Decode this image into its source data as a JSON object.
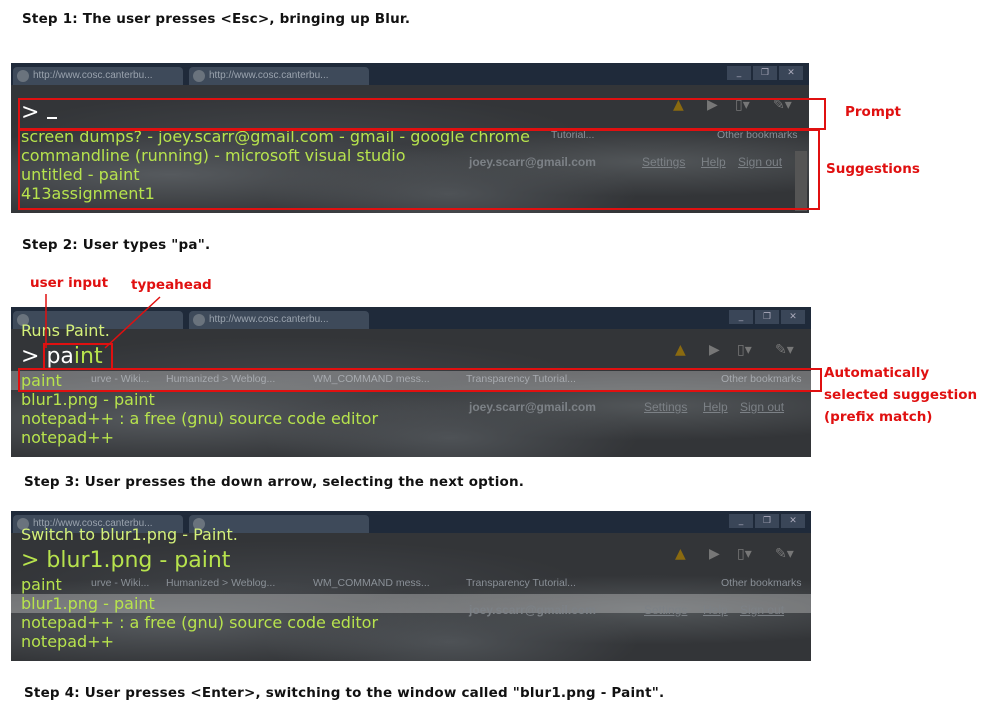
{
  "steps": {
    "s1": "Step 1: The user presses <Esc>, bringing up Blur.",
    "s2": "Step 2: User types \"pa\".",
    "s3": "Step 3: User presses the down arrow, selecting the next option.",
    "s4": "Step 4: User presses <Enter>, switching to the window called \"blur1.png - Paint\"."
  },
  "browser": {
    "tab1": "http://www.cosc.canterbu...",
    "tab2": "http://www.cosc.canterbu...",
    "account": "joey.scarr@gmail.com",
    "settings": "Settings",
    "help": "Help",
    "signout": "Sign out",
    "other_bookmarks": "Other bookmarks",
    "bookmark_tutorial": "Tutorial...",
    "bookmarks": [
      "urve - Wiki...",
      "Humanized > Weblog...",
      "WM_COMMAND mess...",
      "Transparency Tutorial..."
    ]
  },
  "shot1": {
    "prompt": ">",
    "suggestions": [
      "screen dumps? - joey.scarr@gmail.com - gmail - google chrome",
      "commandline (running) - microsoft visual studio",
      "untitled - paint",
      "413assignment1"
    ]
  },
  "shot2": {
    "status": "Runs Paint.",
    "prompt": ">",
    "typed": "pa",
    "typeahead": "int",
    "suggestions": [
      "paint",
      "blur1.png - paint",
      "notepad++ : a free (gnu) source code editor",
      "notepad++"
    ]
  },
  "shot3": {
    "status": "Switch to blur1.png - Paint.",
    "prompt": "> blur1.png - paint",
    "suggestions": [
      "paint",
      "blur1.png - paint",
      "notepad++ : a free (gnu) source code editor",
      "notepad++"
    ]
  },
  "annotations": {
    "prompt": "Prompt",
    "suggestions": "Suggestions",
    "user_input": "user input",
    "typeahead": "typeahead",
    "auto_selected": [
      "Automatically",
      "selected suggestion",
      "(prefix match)"
    ]
  }
}
